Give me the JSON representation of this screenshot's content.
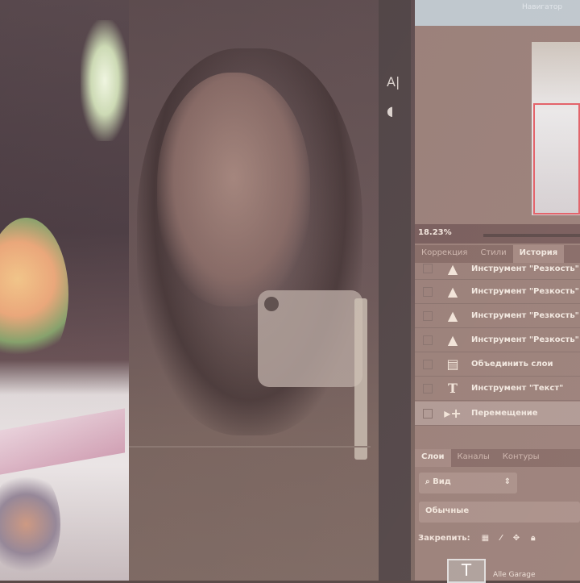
{
  "navigator": {
    "title": "Навигатор",
    "zoom": "18.23%"
  },
  "history_tabs": [
    {
      "label": "Коррекция"
    },
    {
      "label": "Стили"
    },
    {
      "label": "История"
    }
  ],
  "history": [
    {
      "label": "Инструмент \"Резкость\"",
      "icon": "sharpen-icon"
    },
    {
      "label": "Инструмент \"Резкость\"",
      "icon": "sharpen-icon"
    },
    {
      "label": "Инструмент \"Резкость\"",
      "icon": "sharpen-icon"
    },
    {
      "label": "Инструмент \"Резкость\"",
      "icon": "sharpen-icon"
    },
    {
      "label": "Объединить слои",
      "icon": "merge-icon"
    },
    {
      "label": "Инструмент \"Текст\"",
      "icon": "text-icon"
    },
    {
      "label": "Перемещение",
      "icon": "move-icon"
    }
  ],
  "layers_tabs": [
    {
      "label": "Слои"
    },
    {
      "label": "Каналы"
    },
    {
      "label": "Контуры"
    }
  ],
  "layers": {
    "filter": "Вид",
    "blend_mode": "Обычные",
    "lock_label": "Закрепить:",
    "layer_name": "Alle Garage"
  }
}
